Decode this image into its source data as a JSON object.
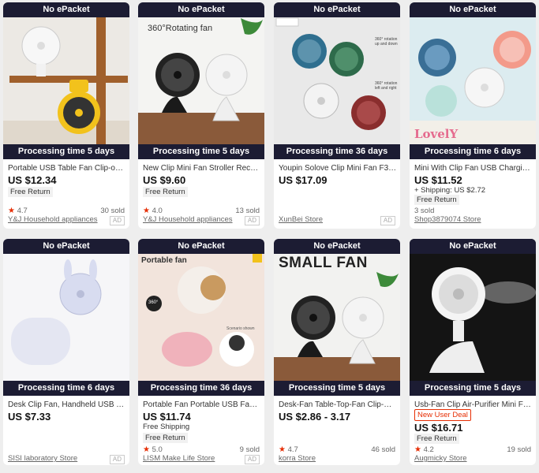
{
  "products": [
    {
      "badge": "No ePacket",
      "processing": "Processing time 5 days",
      "title": "Portable USB Table Fan Clip-on Ty...",
      "price": "US $12.34",
      "free_return": "Free Return",
      "rating": "4.7",
      "sold": "30 sold",
      "store": "Y&J Household appliances",
      "ad": "AD"
    },
    {
      "badge": "No ePacket",
      "processing": "Processing time 5 days",
      "title": "New Clip Mini Fan Stroller Recharg...",
      "price": "US $9.60",
      "free_return": "Free Return",
      "rating": "4.0",
      "sold": "13 sold",
      "store": "Y&J Household appliances",
      "ad": "AD",
      "image_text": "360°Rotating fan"
    },
    {
      "badge": "No ePacket",
      "processing": "Processing time 36 days",
      "title": "Youpin Solove Clip Mini Fan F3 Por...",
      "price": "US $17.09",
      "store": "XunBei Store",
      "ad": "AD",
      "image_text": [
        "360° rotation up and down",
        "360° rotation left and right"
      ]
    },
    {
      "badge": "No ePacket",
      "processing": "Processing time 6 days",
      "title": "Mini With Clip Fan USB Charging Fr...",
      "price": "US $11.52",
      "shipping": "+ Shipping: US $2.72",
      "sold": "3 sold",
      "store": "Shop3879074 Store",
      "free_return": "Free Return",
      "image_text": "LovelY"
    },
    {
      "badge": "No ePacket",
      "processing": "Processing time 6 days",
      "title": "Desk Clip Fan, Handheld USB Tabl...",
      "price": "US $7.33",
      "store": "SISI laboratory Store",
      "ad": "AD"
    },
    {
      "badge": "No ePacket",
      "processing": "Processing time 36 days",
      "title": "Portable Fan Portable USB Fan Cli...",
      "price": "US $11.74",
      "shipping": "Free Shipping",
      "free_return": "Free Return",
      "rating": "5.0",
      "sold": "9 sold",
      "store": "LISM Make Life Store",
      "ad": "AD",
      "image_text": [
        "Portable fan",
        "360°",
        "Scenario shown"
      ]
    },
    {
      "badge": "No ePacket",
      "processing": "Processing time 5 days",
      "title": "Desk-Fan Table-Top-Fan Clip-On O...",
      "price": "US $2.86 - 3.17",
      "rating": "4.7",
      "sold": "46 sold",
      "store": "korra Store",
      "image_text": "SMALL FAN"
    },
    {
      "badge": "No ePacket",
      "processing": "Processing time 5 days",
      "title": "Usb-Fan Clip Air-Purifier Mini Fans ...",
      "new_user_deal": "New User Deal",
      "price": "US $16.71",
      "free_return": "Free Return",
      "rating": "4.2",
      "sold": "19 sold",
      "store": "Augmicky Store"
    }
  ],
  "colors": {
    "badge_bg": "#1c1c33",
    "rating_star": "#e62e04",
    "new_user_deal": "#e62e04",
    "page_bg": "#eeeeee"
  },
  "icons": {
    "rating": "star-icon"
  }
}
